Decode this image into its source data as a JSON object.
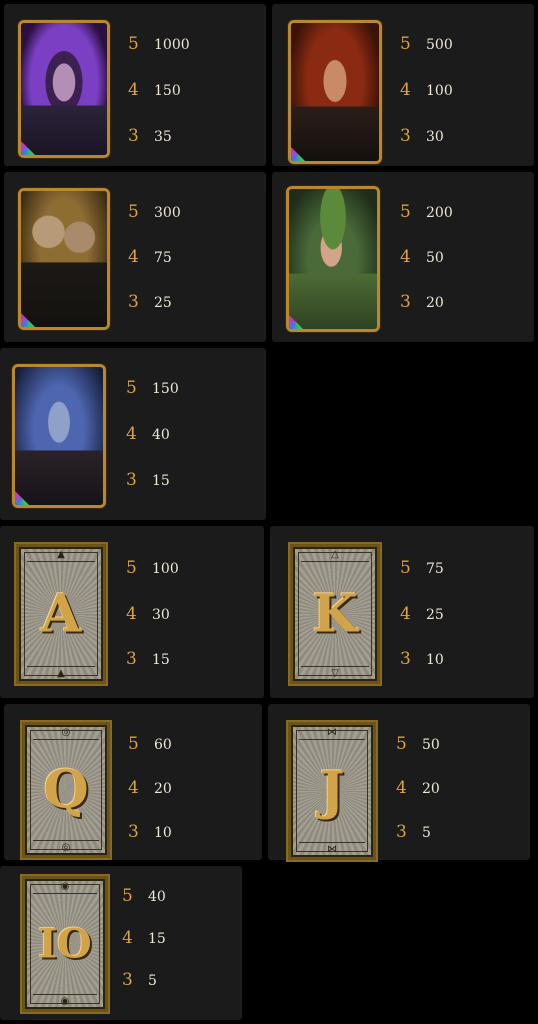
{
  "symbols": [
    {
      "id": "bald-villain",
      "pays": [
        {
          "count": "5",
          "value": "1000"
        },
        {
          "count": "4",
          "value": "150"
        },
        {
          "count": "3",
          "value": "35"
        }
      ],
      "colors": {
        "bg": "#5d2d9a",
        "face": "#b48fb5"
      }
    },
    {
      "id": "red-haired-woman",
      "pays": [
        {
          "count": "5",
          "value": "500"
        },
        {
          "count": "4",
          "value": "100"
        },
        {
          "count": "3",
          "value": "30"
        }
      ],
      "colors": {
        "bg": "#5a1e10",
        "face": "#c98a68"
      }
    },
    {
      "id": "twin-monks",
      "pays": [
        {
          "count": "5",
          "value": "300"
        },
        {
          "count": "4",
          "value": "75"
        },
        {
          "count": "3",
          "value": "25"
        }
      ],
      "colors": {
        "bg": "#6b5123",
        "face": "#b79a78"
      }
    },
    {
      "id": "green-cap-woman",
      "pays": [
        {
          "count": "5",
          "value": "200"
        },
        {
          "count": "4",
          "value": "50"
        },
        {
          "count": "3",
          "value": "20"
        }
      ],
      "colors": {
        "bg": "#2f4a2a",
        "face": "#d3a48a"
      }
    },
    {
      "id": "blue-man",
      "pays": [
        {
          "count": "5",
          "value": "150"
        },
        {
          "count": "4",
          "value": "40"
        },
        {
          "count": "3",
          "value": "15"
        }
      ],
      "colors": {
        "bg": "#2a3f7a",
        "face": "#8fa0c9"
      }
    },
    {
      "id": "letter-a",
      "glyph": "A",
      "pays": [
        {
          "count": "5",
          "value": "100"
        },
        {
          "count": "4",
          "value": "30"
        },
        {
          "count": "3",
          "value": "15"
        }
      ]
    },
    {
      "id": "letter-k",
      "glyph": "K",
      "pays": [
        {
          "count": "5",
          "value": "75"
        },
        {
          "count": "4",
          "value": "25"
        },
        {
          "count": "3",
          "value": "10"
        }
      ]
    },
    {
      "id": "letter-q",
      "glyph": "Q",
      "pays": [
        {
          "count": "5",
          "value": "60"
        },
        {
          "count": "4",
          "value": "20"
        },
        {
          "count": "3",
          "value": "10"
        }
      ]
    },
    {
      "id": "letter-j",
      "glyph": "J",
      "pays": [
        {
          "count": "5",
          "value": "50"
        },
        {
          "count": "4",
          "value": "20"
        },
        {
          "count": "3",
          "value": "5"
        }
      ]
    },
    {
      "id": "letter-10",
      "glyph": "IO",
      "pays": [
        {
          "count": "5",
          "value": "40"
        },
        {
          "count": "4",
          "value": "15"
        },
        {
          "count": "3",
          "value": "5"
        }
      ]
    }
  ],
  "theme": {
    "count_color": "#d9a441",
    "value_color": "#ece6d6",
    "panel_color": "#1b1b1b",
    "frame_color": "#b8872e"
  }
}
